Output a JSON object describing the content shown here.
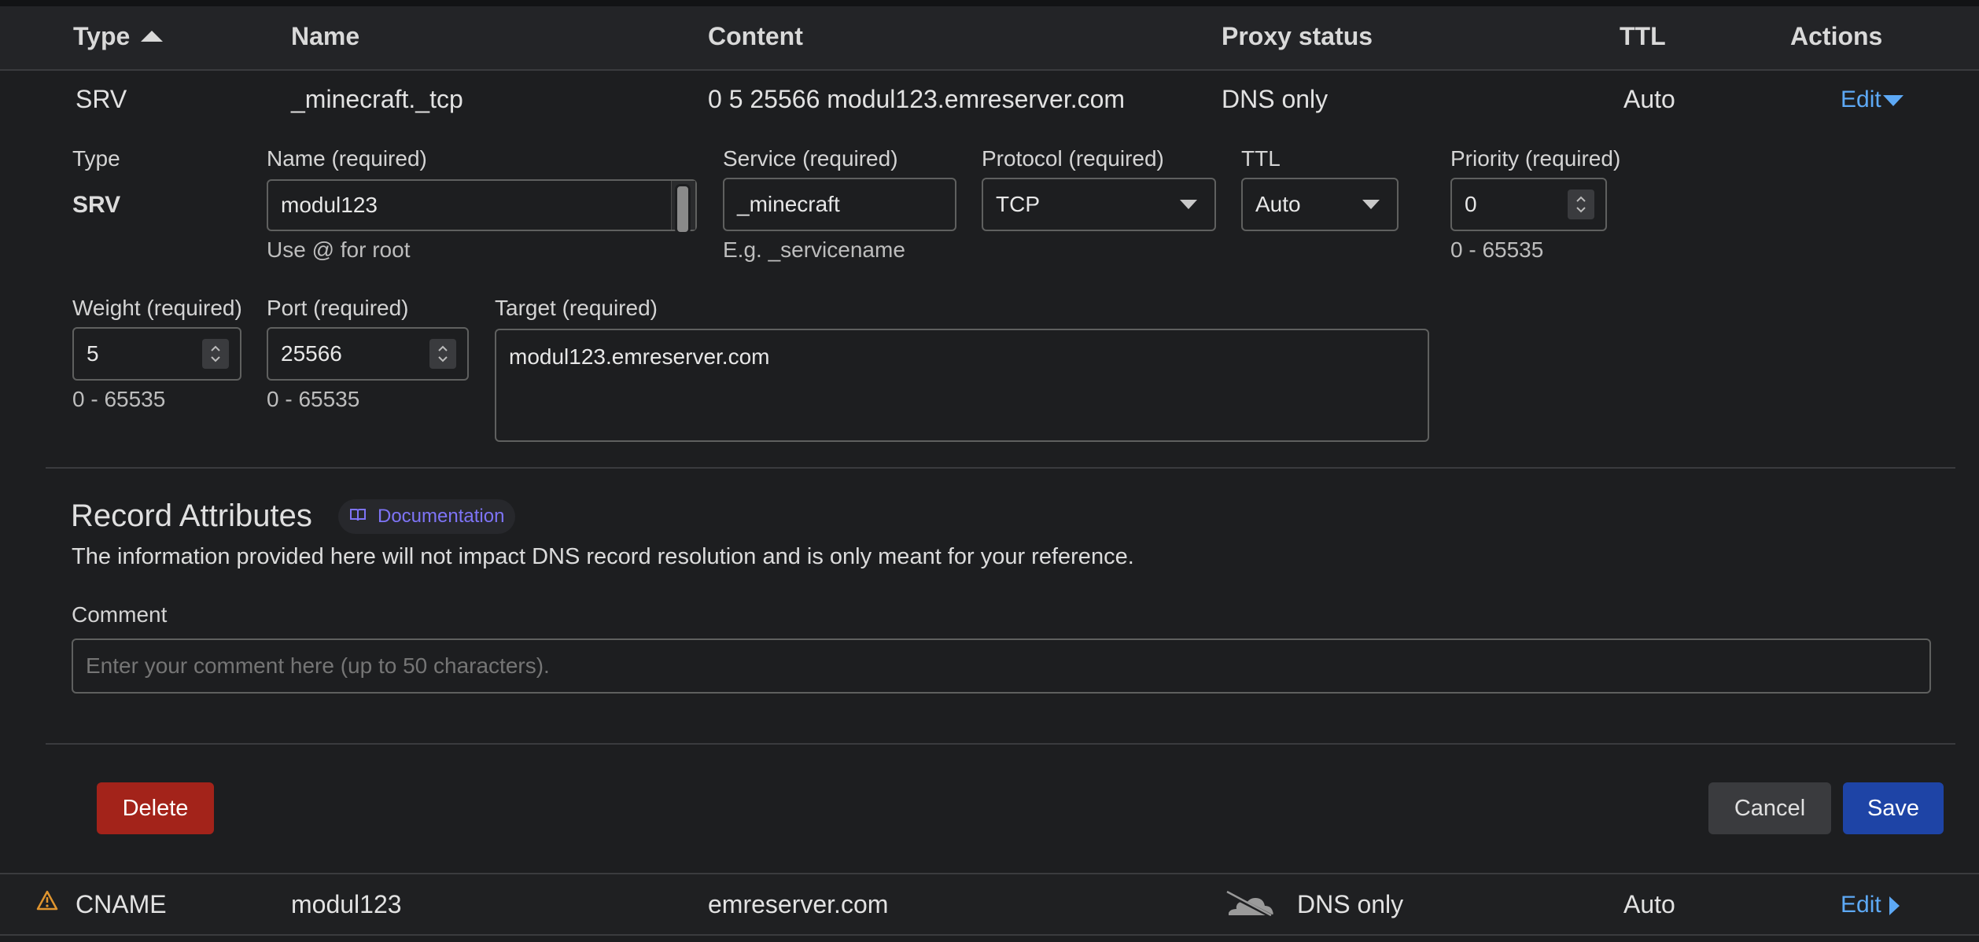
{
  "header": {
    "type": "Type",
    "name": "Name",
    "content": "Content",
    "proxy_status": "Proxy status",
    "ttl": "TTL",
    "actions": "Actions"
  },
  "record_row": {
    "type": "SRV",
    "name": "_minecraft._tcp",
    "content": "0 5 25566 modul123.emreserver.com",
    "proxy_status": "DNS only",
    "ttl": "Auto",
    "action": "Edit"
  },
  "editor": {
    "type_label": "Type",
    "type_value": "SRV",
    "name_label": "Name (required)",
    "name_value": "modul123",
    "name_hint": "Use @ for root",
    "service_label": "Service (required)",
    "service_value": "_minecraft",
    "service_hint": "E.g. _servicename",
    "protocol_label": "Protocol (required)",
    "protocol_value": "TCP",
    "ttl_label": "TTL",
    "ttl_value": "Auto",
    "priority_label": "Priority (required)",
    "priority_value": "0",
    "priority_hint": "0 - 65535",
    "weight_label": "Weight (required)",
    "weight_value": "5",
    "weight_hint": "0 - 65535",
    "port_label": "Port (required)",
    "port_value": "25566",
    "port_hint": "0 - 65535",
    "target_label": "Target (required)",
    "target_value": "modul123.emreserver.com"
  },
  "attributes": {
    "title": "Record Attributes",
    "doc_link": "Documentation",
    "description": "The information provided here will not impact DNS record resolution and is only meant for your reference.",
    "comment_label": "Comment",
    "comment_placeholder": "Enter your comment here (up to 50 characters)."
  },
  "buttons": {
    "delete": "Delete",
    "cancel": "Cancel",
    "save": "Save"
  },
  "next_row": {
    "type": "CNAME",
    "name": "modul123",
    "content": "emreserver.com",
    "proxy_status": "DNS only",
    "ttl": "Auto",
    "action": "Edit"
  },
  "colors": {
    "link": "#5da9f6",
    "delete": "#a3231a",
    "save": "#1e44a6",
    "cancel": "#3a3b3e",
    "doc_accent": "#7e74f6",
    "warning": "#e0952f"
  }
}
